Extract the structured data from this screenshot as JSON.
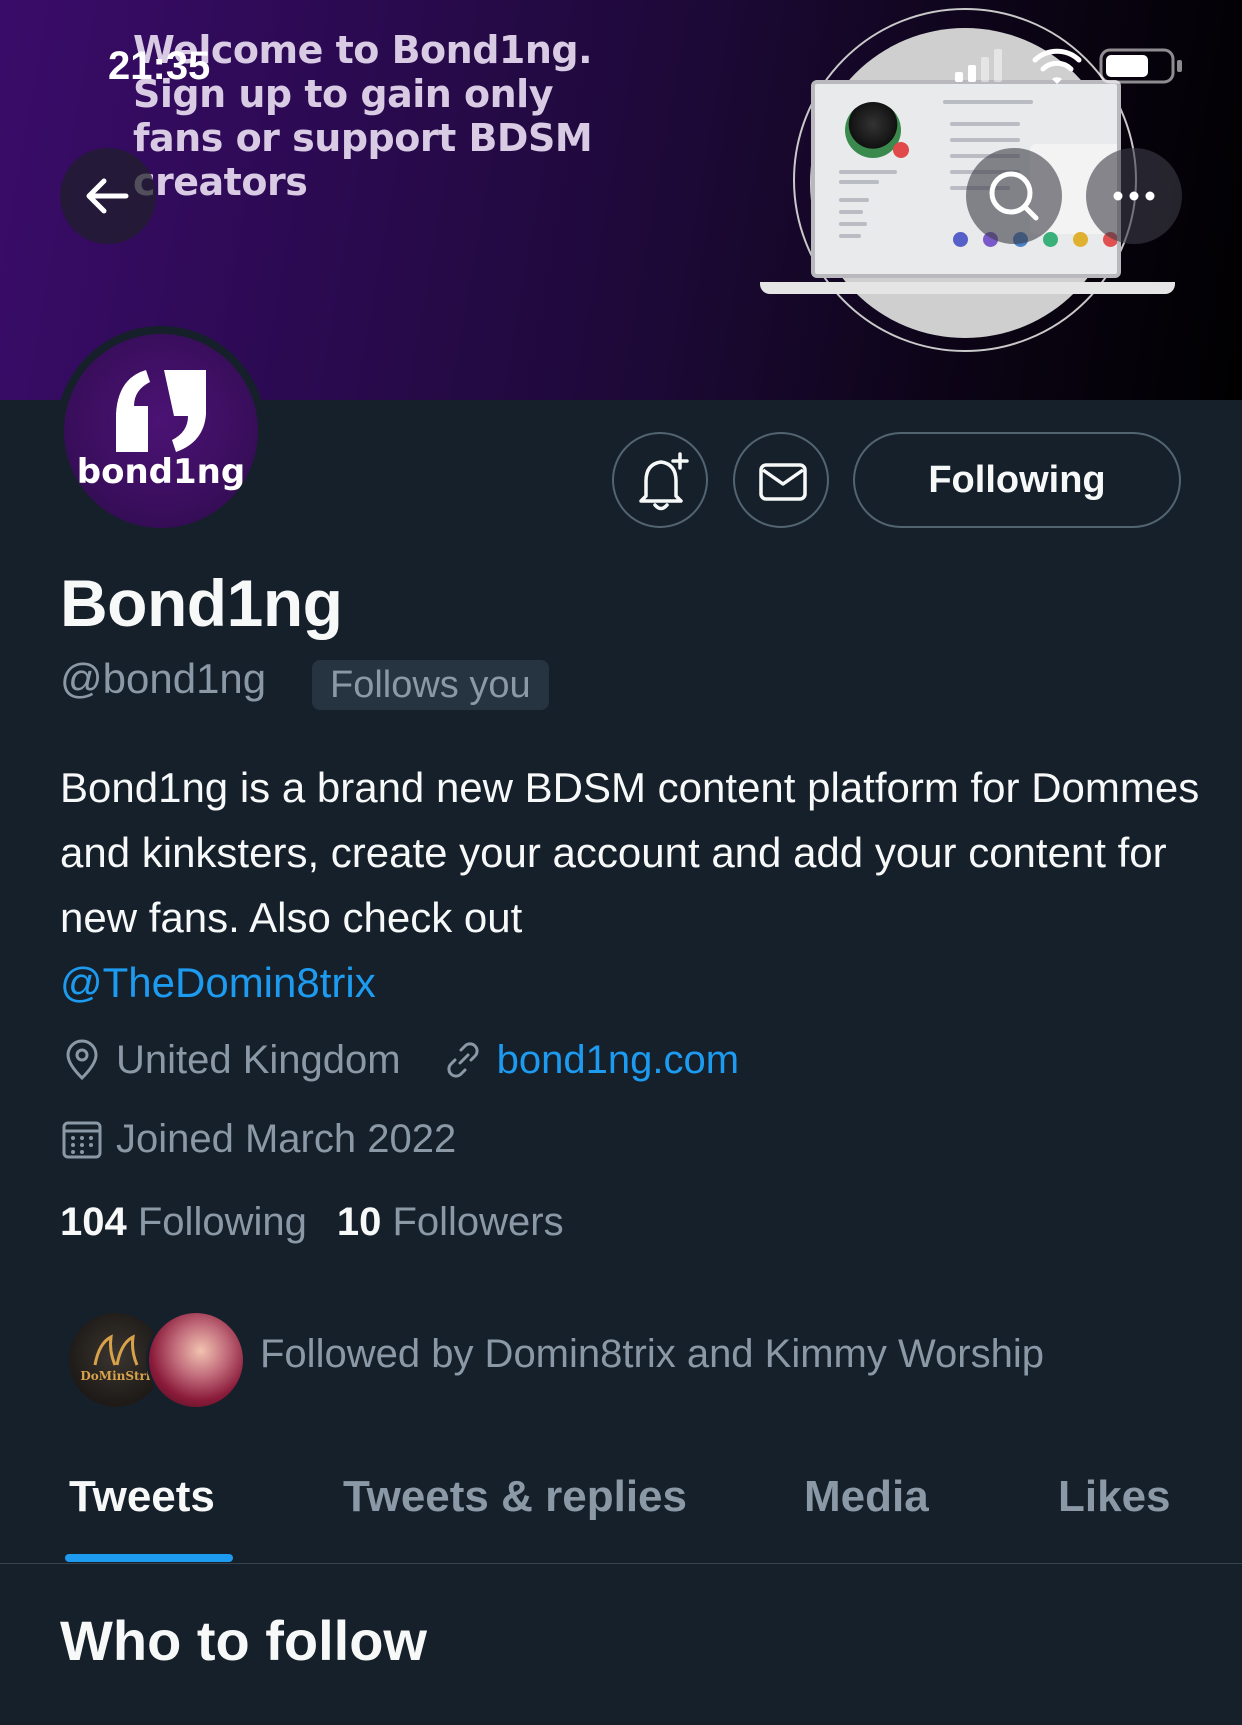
{
  "status_bar": {
    "time": "21:35"
  },
  "banner": {
    "lines": [
      "Welcome to Bond1ng.",
      "Sign up to gain only",
      "fans or support BDSM",
      "creators"
    ]
  },
  "avatar": {
    "logo_text": "bond1ng"
  },
  "actions": {
    "following_label": "Following"
  },
  "profile": {
    "display_name": "Bond1ng",
    "handle": "@bond1ng",
    "follows_you": "Follows you",
    "bio_text": "Bond1ng is a brand new BDSM content platform for Dommes and kinksters, create your account and add your content for new fans. Also check out",
    "bio_mention": "@TheDomin8trix",
    "location": "United Kingdom",
    "website": "bond1ng.com",
    "joined": "Joined March 2022",
    "following_count": "104",
    "following_label": "Following",
    "followers_count": "10",
    "followers_label": "Followers",
    "followed_by": "Followed by Domin8trix and Kimmy Worship",
    "followed_by_avatar1_text": "DoMinStrix"
  },
  "tabs": [
    {
      "label": "Tweets",
      "active": true
    },
    {
      "label": "Tweets & replies",
      "active": false
    },
    {
      "label": "Media",
      "active": false
    },
    {
      "label": "Likes",
      "active": false
    }
  ],
  "section": {
    "who_to_follow": "Who to follow"
  },
  "colors": {
    "background": "#15202b",
    "accent": "#1d9bf0",
    "secondary_text": "#8b98a5"
  }
}
